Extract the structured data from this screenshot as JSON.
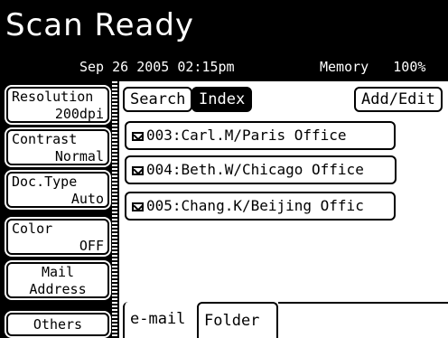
{
  "header": {
    "title": "Scan Ready",
    "datetime": "Sep 26 2005 02:15pm",
    "memory_label": "Memory",
    "memory_value": "100%"
  },
  "sidebar": [
    {
      "line1": "Resolution",
      "line2": "200dpi"
    },
    {
      "line1": "Contrast",
      "line2": "Normal"
    },
    {
      "line1": "Doc.Type",
      "line2": "Auto"
    },
    {
      "line1": "Color",
      "line2": "OFF"
    },
    {
      "line1": "Mail",
      "line2": "Address"
    },
    {
      "line1": "Others",
      "line2": ""
    }
  ],
  "toolbar": {
    "search": "Search",
    "index": "Index",
    "add_edit": "Add/Edit"
  },
  "entries": [
    {
      "label": "003:Carl.M/Paris Office",
      "icon": "mail-icon"
    },
    {
      "label": "004:Beth.W/Chicago Office",
      "icon": "mail-icon"
    },
    {
      "label": "005:Chang.K/Beijing Offic",
      "icon": "mail-icon"
    }
  ],
  "bottom_tabs": {
    "email": "e-mail",
    "folder": "Folder"
  }
}
